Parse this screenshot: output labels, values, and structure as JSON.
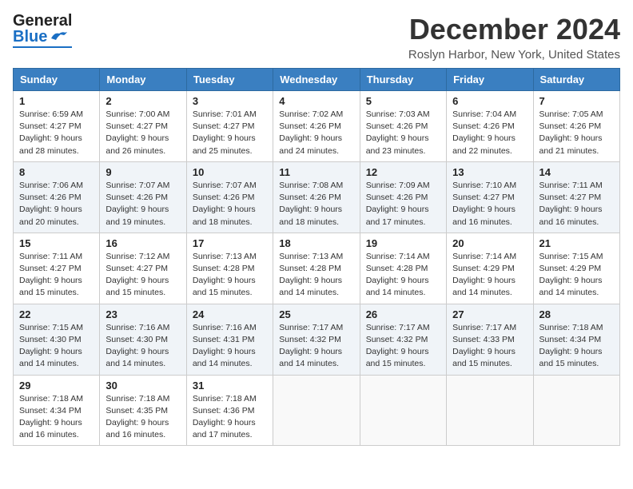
{
  "header": {
    "logo_line1": "General",
    "logo_line2": "Blue",
    "month_title": "December 2024",
    "subtitle": "Roslyn Harbor, New York, United States"
  },
  "days_of_week": [
    "Sunday",
    "Monday",
    "Tuesday",
    "Wednesday",
    "Thursday",
    "Friday",
    "Saturday"
  ],
  "weeks": [
    [
      {
        "day": "1",
        "sunrise": "6:59 AM",
        "sunset": "4:27 PM",
        "daylight": "9 hours and 28 minutes."
      },
      {
        "day": "2",
        "sunrise": "7:00 AM",
        "sunset": "4:27 PM",
        "daylight": "9 hours and 26 minutes."
      },
      {
        "day": "3",
        "sunrise": "7:01 AM",
        "sunset": "4:27 PM",
        "daylight": "9 hours and 25 minutes."
      },
      {
        "day": "4",
        "sunrise": "7:02 AM",
        "sunset": "4:26 PM",
        "daylight": "9 hours and 24 minutes."
      },
      {
        "day": "5",
        "sunrise": "7:03 AM",
        "sunset": "4:26 PM",
        "daylight": "9 hours and 23 minutes."
      },
      {
        "day": "6",
        "sunrise": "7:04 AM",
        "sunset": "4:26 PM",
        "daylight": "9 hours and 22 minutes."
      },
      {
        "day": "7",
        "sunrise": "7:05 AM",
        "sunset": "4:26 PM",
        "daylight": "9 hours and 21 minutes."
      }
    ],
    [
      {
        "day": "8",
        "sunrise": "7:06 AM",
        "sunset": "4:26 PM",
        "daylight": "9 hours and 20 minutes."
      },
      {
        "day": "9",
        "sunrise": "7:07 AM",
        "sunset": "4:26 PM",
        "daylight": "9 hours and 19 minutes."
      },
      {
        "day": "10",
        "sunrise": "7:07 AM",
        "sunset": "4:26 PM",
        "daylight": "9 hours and 18 minutes."
      },
      {
        "day": "11",
        "sunrise": "7:08 AM",
        "sunset": "4:26 PM",
        "daylight": "9 hours and 18 minutes."
      },
      {
        "day": "12",
        "sunrise": "7:09 AM",
        "sunset": "4:26 PM",
        "daylight": "9 hours and 17 minutes."
      },
      {
        "day": "13",
        "sunrise": "7:10 AM",
        "sunset": "4:27 PM",
        "daylight": "9 hours and 16 minutes."
      },
      {
        "day": "14",
        "sunrise": "7:11 AM",
        "sunset": "4:27 PM",
        "daylight": "9 hours and 16 minutes."
      }
    ],
    [
      {
        "day": "15",
        "sunrise": "7:11 AM",
        "sunset": "4:27 PM",
        "daylight": "9 hours and 15 minutes."
      },
      {
        "day": "16",
        "sunrise": "7:12 AM",
        "sunset": "4:27 PM",
        "daylight": "9 hours and 15 minutes."
      },
      {
        "day": "17",
        "sunrise": "7:13 AM",
        "sunset": "4:28 PM",
        "daylight": "9 hours and 15 minutes."
      },
      {
        "day": "18",
        "sunrise": "7:13 AM",
        "sunset": "4:28 PM",
        "daylight": "9 hours and 14 minutes."
      },
      {
        "day": "19",
        "sunrise": "7:14 AM",
        "sunset": "4:28 PM",
        "daylight": "9 hours and 14 minutes."
      },
      {
        "day": "20",
        "sunrise": "7:14 AM",
        "sunset": "4:29 PM",
        "daylight": "9 hours and 14 minutes."
      },
      {
        "day": "21",
        "sunrise": "7:15 AM",
        "sunset": "4:29 PM",
        "daylight": "9 hours and 14 minutes."
      }
    ],
    [
      {
        "day": "22",
        "sunrise": "7:15 AM",
        "sunset": "4:30 PM",
        "daylight": "9 hours and 14 minutes."
      },
      {
        "day": "23",
        "sunrise": "7:16 AM",
        "sunset": "4:30 PM",
        "daylight": "9 hours and 14 minutes."
      },
      {
        "day": "24",
        "sunrise": "7:16 AM",
        "sunset": "4:31 PM",
        "daylight": "9 hours and 14 minutes."
      },
      {
        "day": "25",
        "sunrise": "7:17 AM",
        "sunset": "4:32 PM",
        "daylight": "9 hours and 14 minutes."
      },
      {
        "day": "26",
        "sunrise": "7:17 AM",
        "sunset": "4:32 PM",
        "daylight": "9 hours and 15 minutes."
      },
      {
        "day": "27",
        "sunrise": "7:17 AM",
        "sunset": "4:33 PM",
        "daylight": "9 hours and 15 minutes."
      },
      {
        "day": "28",
        "sunrise": "7:18 AM",
        "sunset": "4:34 PM",
        "daylight": "9 hours and 15 minutes."
      }
    ],
    [
      {
        "day": "29",
        "sunrise": "7:18 AM",
        "sunset": "4:34 PM",
        "daylight": "9 hours and 16 minutes."
      },
      {
        "day": "30",
        "sunrise": "7:18 AM",
        "sunset": "4:35 PM",
        "daylight": "9 hours and 16 minutes."
      },
      {
        "day": "31",
        "sunrise": "7:18 AM",
        "sunset": "4:36 PM",
        "daylight": "9 hours and 17 minutes."
      },
      null,
      null,
      null,
      null
    ]
  ],
  "labels": {
    "sunrise": "Sunrise:",
    "sunset": "Sunset:",
    "daylight": "Daylight:"
  }
}
